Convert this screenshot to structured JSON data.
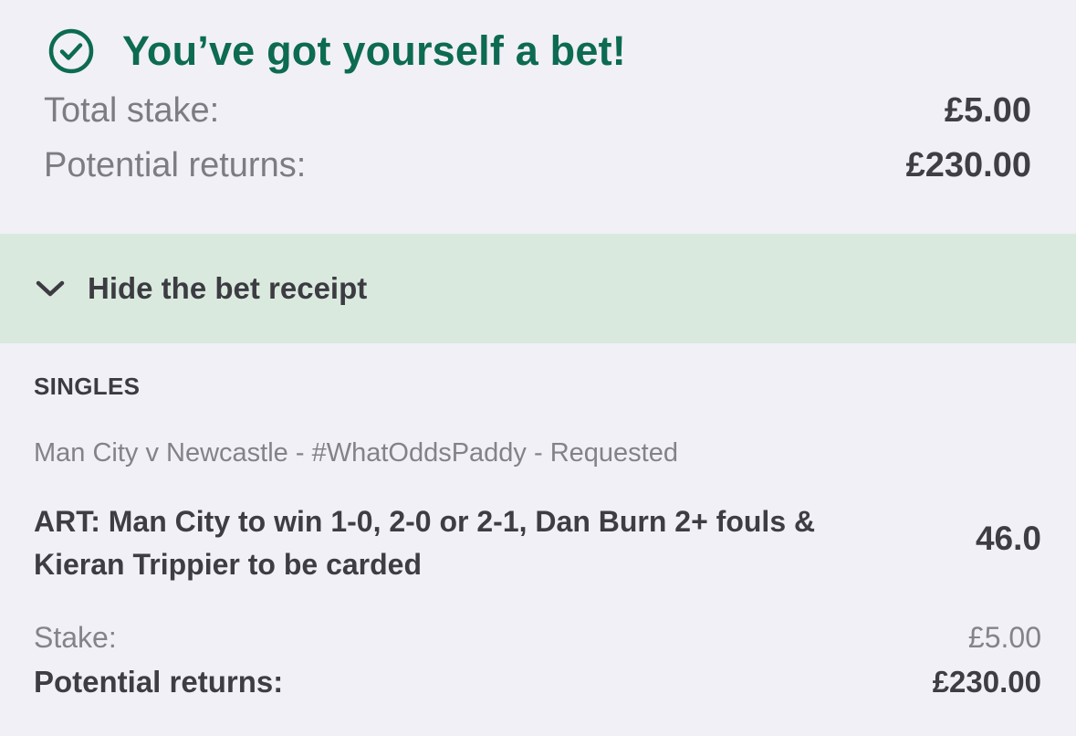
{
  "confirmation": {
    "icon": "check-circle-icon",
    "title": "You’ve got yourself a bet!",
    "total_stake_label": "Total stake:",
    "total_stake_value": "£5.00",
    "potential_returns_label": "Potential returns:",
    "potential_returns_value": "£230.00"
  },
  "receipt_toggle": {
    "icon": "chevron-down-icon",
    "label": "Hide the bet receipt"
  },
  "receipt": {
    "section_title": "SINGLES",
    "event": "Man City v Newcastle - #WhatOddsPaddy - Requested",
    "selection": "ART: Man City to win 1-0, 2-0 or 2-1, Dan Burn 2+ fouls & Kieran Trippier to be carded",
    "odds": "46.0",
    "stake_label": "Stake:",
    "stake_value": "£5.00",
    "potential_returns_label": "Potential returns:",
    "potential_returns_value": "£230.00"
  },
  "colors": {
    "accent_green": "#0c6b52",
    "toggle_background": "#d9e9de",
    "page_background": "#f1f0f6"
  }
}
